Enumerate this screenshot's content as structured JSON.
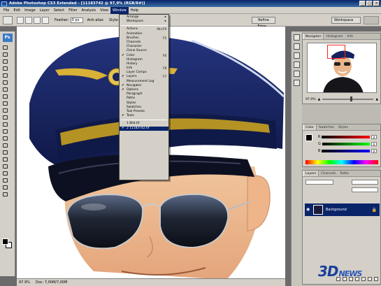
{
  "window": {
    "title": "Adobe Photoshop CS3 Extended - [11183742 @ 97,9% (RGB/8#)]",
    "controls": [
      "_",
      "□",
      "×"
    ]
  },
  "menubar": {
    "items": [
      "File",
      "Edit",
      "Image",
      "Layer",
      "Select",
      "Filter",
      "Analysis",
      "View",
      "Window",
      "Help"
    ],
    "active": "Window"
  },
  "options": {
    "feather_label": "Feather:",
    "feather_value": "0 px",
    "antialias_label": "Anti-alias",
    "style_label": "Style:",
    "refine_label": "Refine Edge...",
    "workspace_label": "Workspace"
  },
  "window_menu": {
    "items": [
      {
        "label": "Arrange",
        "submenu": true
      },
      {
        "label": "Workspace",
        "submenu": true
      },
      {
        "sep": true
      },
      {
        "label": "Actions",
        "shortcut": "Alt+F9"
      },
      {
        "label": "Animation"
      },
      {
        "label": "Brushes",
        "shortcut": "F5"
      },
      {
        "label": "Channels"
      },
      {
        "label": "Character"
      },
      {
        "label": "Clone Source"
      },
      {
        "label": "Color",
        "checked": true,
        "shortcut": "F6"
      },
      {
        "label": "Histogram"
      },
      {
        "label": "History"
      },
      {
        "label": "Info",
        "shortcut": "F8"
      },
      {
        "label": "Layer Comps"
      },
      {
        "label": "Layers",
        "checked": true,
        "shortcut": "F7"
      },
      {
        "label": "Measurement Log"
      },
      {
        "label": "Navigator",
        "checked": true
      },
      {
        "label": "Options",
        "checked": true
      },
      {
        "label": "Paragraph"
      },
      {
        "label": "Paths"
      },
      {
        "label": "Styles"
      },
      {
        "label": "Swatches"
      },
      {
        "label": "Tool Presets"
      },
      {
        "label": "Tools",
        "checked": true
      },
      {
        "sep": true
      },
      {
        "label": "1 Bild.tif"
      },
      {
        "label": "2 11183742.tif",
        "checked": true,
        "highlighted": true
      }
    ]
  },
  "navigator": {
    "tabs": [
      "Navigator",
      "Histogram",
      "Info"
    ],
    "zoom": "97.9%"
  },
  "color_panel": {
    "tabs": [
      "Color",
      "Swatches",
      "Styles"
    ],
    "channels": [
      {
        "label": "R",
        "value": "0"
      },
      {
        "label": "G",
        "value": "0"
      },
      {
        "label": "B",
        "value": "0"
      }
    ]
  },
  "layers_panel": {
    "tabs": [
      "Layers",
      "Channels",
      "Paths"
    ],
    "layer_name": "Background"
  },
  "status": {
    "zoom": "97.9%",
    "doc": "Doc: 7,00M/7,00M"
  },
  "watermark": {
    "main": "3D",
    "suffix": "NEWS"
  },
  "colors": {
    "menu_highlight": "#0a246a",
    "cap_navy": "#16225e",
    "chrome": "#d4d0c8"
  }
}
